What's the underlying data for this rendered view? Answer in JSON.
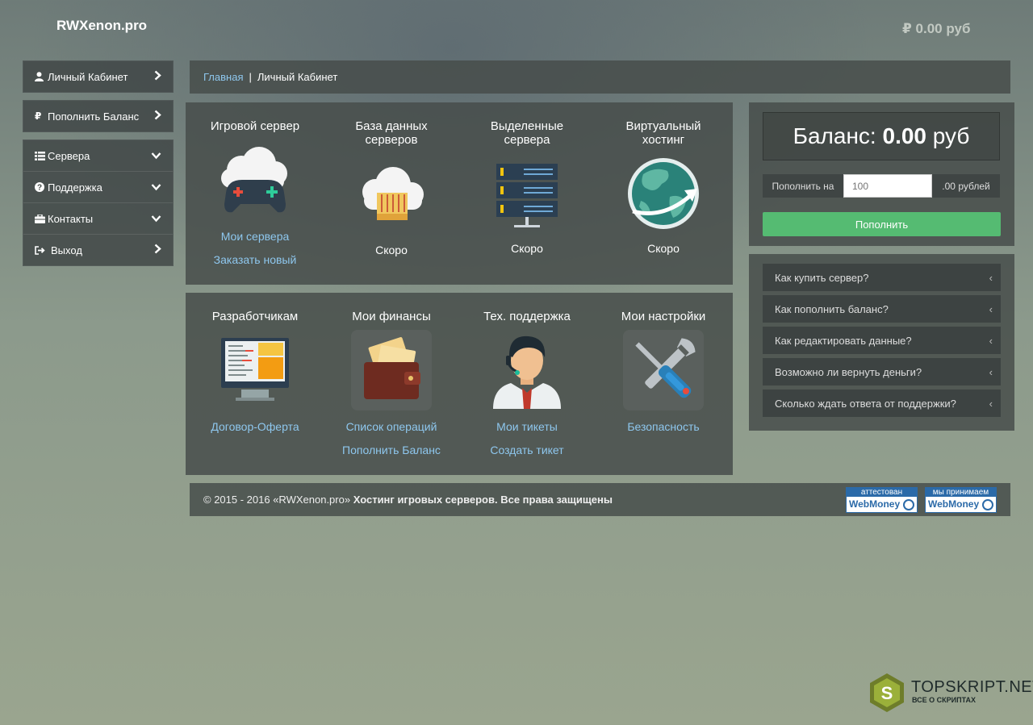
{
  "header": {
    "logo": "RWXenon.pro",
    "balance": "₽ 0.00 руб"
  },
  "sidebar": {
    "items": [
      {
        "label": "Личный Кабинет",
        "icon": "user-icon"
      },
      {
        "label": "Пополнить Баланс",
        "icon": "ruble-icon"
      },
      {
        "label": "Сервера",
        "icon": "list-icon"
      },
      {
        "label": "Поддержка",
        "icon": "question-icon"
      },
      {
        "label": "Контакты",
        "icon": "briefcase-icon"
      },
      {
        "label": "Выход",
        "icon": "sign-out-icon"
      }
    ]
  },
  "breadcrumb": {
    "home": "Главная",
    "separator": "|",
    "current": "Личный Кабинет"
  },
  "services": [
    {
      "title": "Игровой сервер",
      "link1": "Мои сервера",
      "link2": "Заказать новый",
      "icon": "gamepad-cloud-icon"
    },
    {
      "title": "База данных серверов",
      "status": "Скоро",
      "icon": "database-cloud-icon"
    },
    {
      "title": "Выделенные сервера",
      "status": "Скоро",
      "icon": "server-rack-icon"
    },
    {
      "title": "Виртуальный хостинг",
      "status": "Скоро",
      "icon": "globe-icon"
    }
  ],
  "tools": [
    {
      "title": "Разработчикам",
      "link1": "Договор-Оферта",
      "icon": "monitor-code-icon"
    },
    {
      "title": "Мои финансы",
      "link1": "Список операций",
      "link2": "Пополнить Баланс",
      "icon": "wallet-icon"
    },
    {
      "title": "Тех. поддержка",
      "link1": "Мои тикеты",
      "link2": "Создать тикет",
      "icon": "support-agent-icon"
    },
    {
      "title": "Мои настройки",
      "link1": "Безопасность",
      "icon": "tools-icon"
    }
  ],
  "balance_panel": {
    "label": "Баланс:",
    "amount": "0.00",
    "currency": "руб",
    "fill_label": "Пополнить на",
    "fill_placeholder": "100",
    "fill_suffix": ".00 рублей",
    "button": "Пополнить"
  },
  "faq": [
    {
      "q": "Как купить сервер?"
    },
    {
      "q": "Как пополнить баланс?"
    },
    {
      "q": "Как редактировать данные?"
    },
    {
      "q": "Возможно ли вернуть деньги?"
    },
    {
      "q": "Сколько ждать ответа от поддержки?"
    }
  ],
  "footer": {
    "copyright": "© 2015 - 2016 «RWXenon.pro»",
    "tagline": "Хостинг игровых серверов. Все права защищены",
    "badge1_top": "аттестован",
    "badge1_bottom": "WebMoney",
    "badge2_top": "мы принимаем",
    "badge2_bottom": "WebMoney"
  },
  "watermark": {
    "name": "TOPSKRIPT.NET",
    "sub": "ВСЕ О СКРИПТАХ",
    "letter": "S"
  },
  "colors": {
    "accent_link": "#8ec7ee",
    "button_green": "#55bb72",
    "panel": "#464c4a"
  }
}
